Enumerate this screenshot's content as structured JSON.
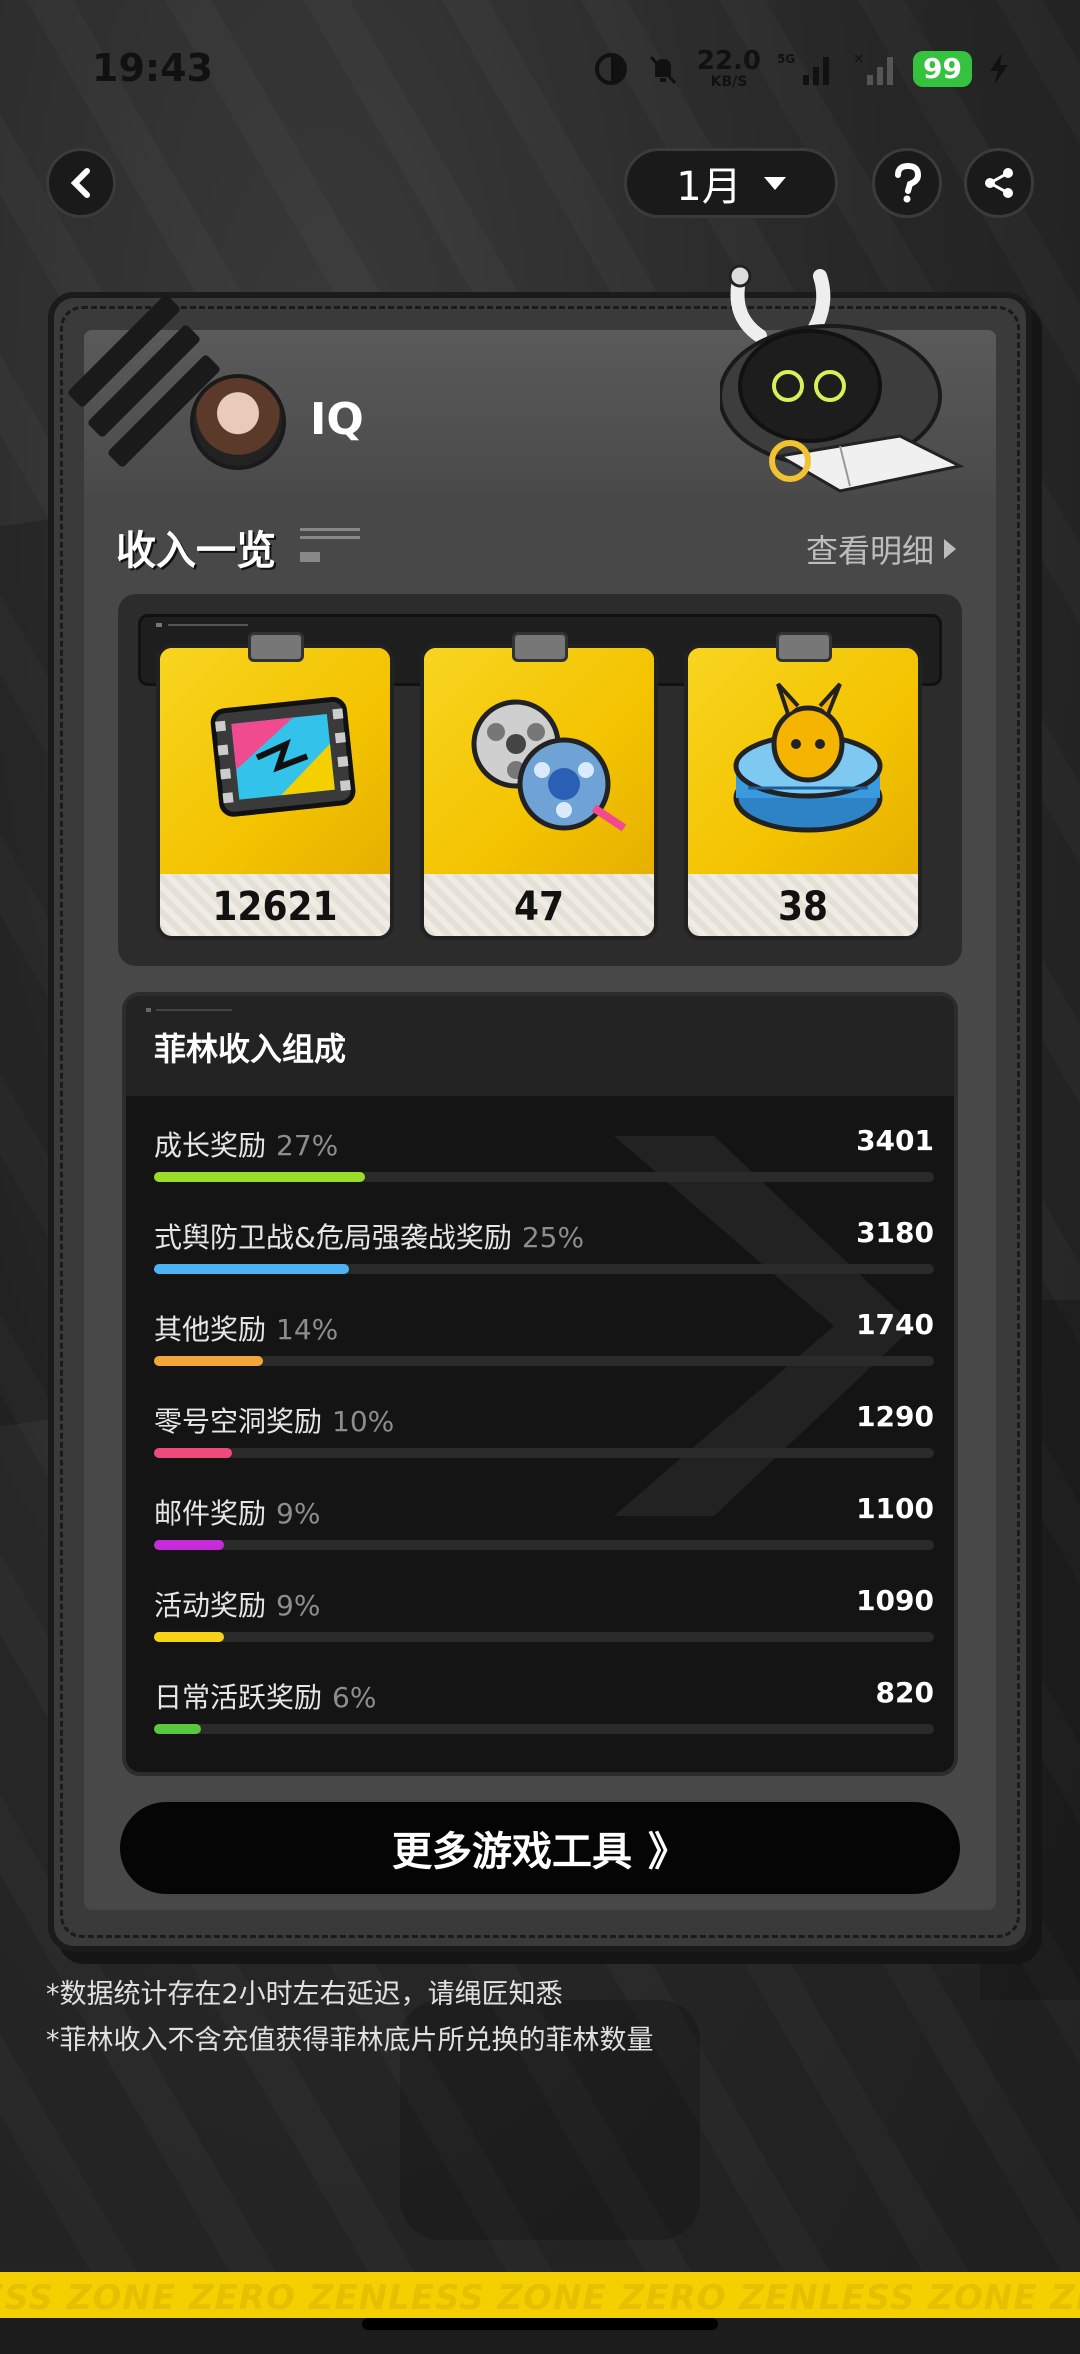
{
  "status_bar": {
    "time": "19:43",
    "net_speed": "22.0",
    "net_unit": "KB/S",
    "network": "5G",
    "battery": "99"
  },
  "nav": {
    "month_label": "1月"
  },
  "profile": {
    "username": "IQ"
  },
  "overview": {
    "title": "收入一览",
    "details_label": "查看明细",
    "rewards": [
      {
        "icon": "polychrome-film-icon",
        "value": "12621"
      },
      {
        "icon": "film-reels-icon",
        "value": "47"
      },
      {
        "icon": "bangboo-coin-icon",
        "value": "38"
      }
    ]
  },
  "breakdown": {
    "title": "菲林收入组成",
    "items": [
      {
        "label": "成长奖励",
        "pct": "27%",
        "value": "3401",
        "fraction": 0.27,
        "color": "#9bdc28"
      },
      {
        "label": "式舆防卫战&危局强袭战奖励",
        "pct": "25%",
        "value": "3180",
        "fraction": 0.25,
        "color": "#4fb3f3"
      },
      {
        "label": "其他奖励",
        "pct": "14%",
        "value": "1740",
        "fraction": 0.14,
        "color": "#f2a73a"
      },
      {
        "label": "零号空洞奖励",
        "pct": "10%",
        "value": "1290",
        "fraction": 0.1,
        "color": "#f04a7a"
      },
      {
        "label": "邮件奖励",
        "pct": "9%",
        "value": "1100",
        "fraction": 0.09,
        "color": "#c52bd9"
      },
      {
        "label": "活动奖励",
        "pct": "9%",
        "value": "1090",
        "fraction": 0.09,
        "color": "#f7d317"
      },
      {
        "label": "日常活跃奖励",
        "pct": "6%",
        "value": "820",
        "fraction": 0.06,
        "color": "#5ac83c"
      }
    ]
  },
  "more_button": {
    "label": "更多游戏工具",
    "arrow": "》"
  },
  "notes": [
    "*数据统计存在2小时左右延迟，请绳匠知悉",
    "*菲林收入不含充值获得菲林底片所兑换的菲林数量"
  ],
  "brand": {
    "text": "ESS ZONE ZERO ZENLESS ZONE ZERO ZENLESS ZONE ZERO ZENLESS ZO",
    "color": "#f5d000"
  }
}
